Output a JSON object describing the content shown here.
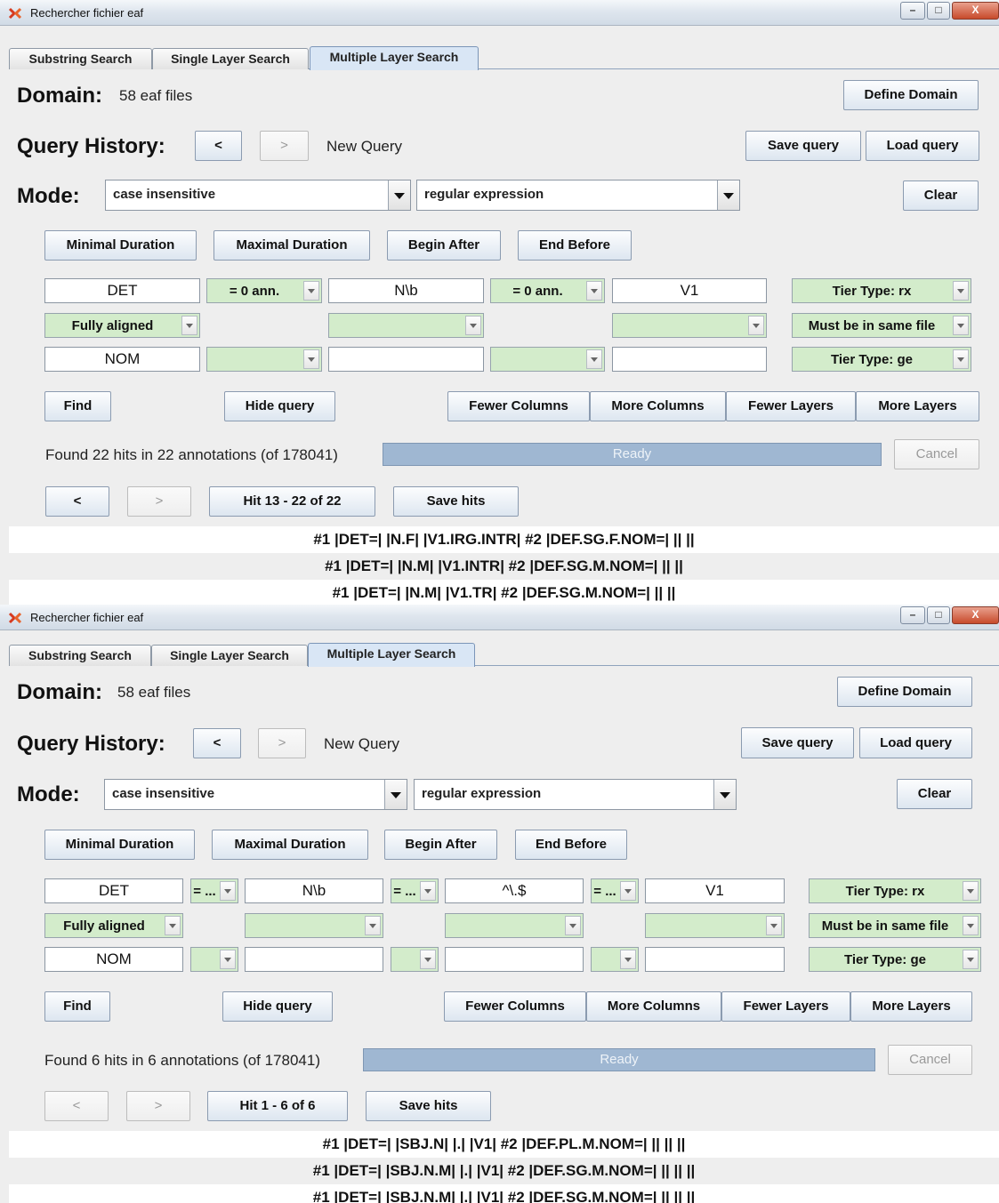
{
  "windows": [
    {
      "title": "Rechercher fichier eaf",
      "tabs": [
        "Substring Search",
        "Single Layer Search",
        "Multiple Layer Search"
      ],
      "active_tab": "Multiple Layer Search",
      "domain_label": "Domain:",
      "domain_value": "58 eaf files",
      "define_domain": "Define Domain",
      "query_history_label": "Query History:",
      "prev_label": "<",
      "next_label": ">",
      "new_query": "New Query",
      "save_query": "Save query",
      "load_query": "Load query",
      "mode_label": "Mode:",
      "mode_case": "case insensitive",
      "mode_type": "regular expression",
      "clear": "Clear",
      "constraints": [
        "Minimal Duration",
        "Maximal Duration",
        "Begin After",
        "End Before"
      ],
      "row1": {
        "f1": "DET",
        "s1": "= 0 ann.",
        "f2": "N\\b",
        "s2": "= 0 ann.",
        "f3": "V1",
        "tier": "Tier Type: rx"
      },
      "row2": {
        "align": "Fully aligned",
        "s1": "",
        "s2": "",
        "file": "Must be in same file"
      },
      "row3": {
        "f1": "NOM",
        "s1": "",
        "f2": "",
        "s2": "",
        "f3": "",
        "tier": "Tier Type: ge"
      },
      "find": "Find",
      "hide_query": "Hide query",
      "fewer_columns": "Fewer Columns",
      "more_columns": "More Columns",
      "fewer_layers": "Fewer Layers",
      "more_layers": "More Layers",
      "status": "Found 22 hits in 22 annotations (of 178041)",
      "progress_text": "Ready",
      "cancel": "Cancel",
      "hit_range": "Hit 13 - 22 of 22",
      "save_hits": "Save hits",
      "results": [
        "#1 |DET=| |N.F| |V1.IRG.INTR|  #2 |DEF.SG.F.NOM=| || ||",
        "#1 |DET=| |N.M| |V1.INTR|  #2 |DEF.SG.M.NOM=| || ||",
        "#1 |DET=| |N.M| |V1.TR|  #2 |DEF.SG.M.NOM=| || ||"
      ]
    },
    {
      "title": "Rechercher fichier eaf",
      "tabs": [
        "Substring Search",
        "Single Layer Search",
        "Multiple Layer Search"
      ],
      "active_tab": "Multiple Layer Search",
      "domain_label": "Domain:",
      "domain_value": "58 eaf files",
      "define_domain": "Define Domain",
      "query_history_label": "Query History:",
      "prev_label": "<",
      "next_label": ">",
      "new_query": "New Query",
      "save_query": "Save query",
      "load_query": "Load query",
      "mode_label": "Mode:",
      "mode_case": "case insensitive",
      "mode_type": "regular expression",
      "clear": "Clear",
      "constraints": [
        "Minimal Duration",
        "Maximal Duration",
        "Begin After",
        "End Before"
      ],
      "row1": {
        "f1": "DET",
        "s1": "= ...",
        "f2": "N\\b",
        "s2": "= ...",
        "f3": "^\\.$",
        "s3": "= ...",
        "f4": "V1",
        "tier": "Tier Type: rx"
      },
      "row2": {
        "align": "Fully aligned",
        "s1": "",
        "s2": "",
        "s3": "",
        "file": "Must be in same file"
      },
      "row3": {
        "f1": "NOM",
        "s1": "",
        "f2": "",
        "s2": "",
        "f3": "",
        "s3": "",
        "f4": "",
        "tier": "Tier Type: ge"
      },
      "find": "Find",
      "hide_query": "Hide query",
      "fewer_columns": "Fewer Columns",
      "more_columns": "More Columns",
      "fewer_layers": "Fewer Layers",
      "more_layers": "More Layers",
      "status": "Found 6 hits in 6 annotations (of 178041)",
      "progress_text": "Ready",
      "cancel": "Cancel",
      "hit_range": "Hit 1 - 6 of 6",
      "save_hits": "Save hits",
      "results": [
        "#1 |DET=| |SBJ.N| |.| |V1|  #2 |DEF.PL.M.NOM=| || || ||",
        "#1 |DET=| |SBJ.N.M| |.| |V1|  #2 |DEF.SG.M.NOM=| || || ||",
        "#1 |DET=| |SBJ.N.M| |.| |V1|  #2 |DEF.SG.M.NOM=| || || ||"
      ]
    }
  ]
}
